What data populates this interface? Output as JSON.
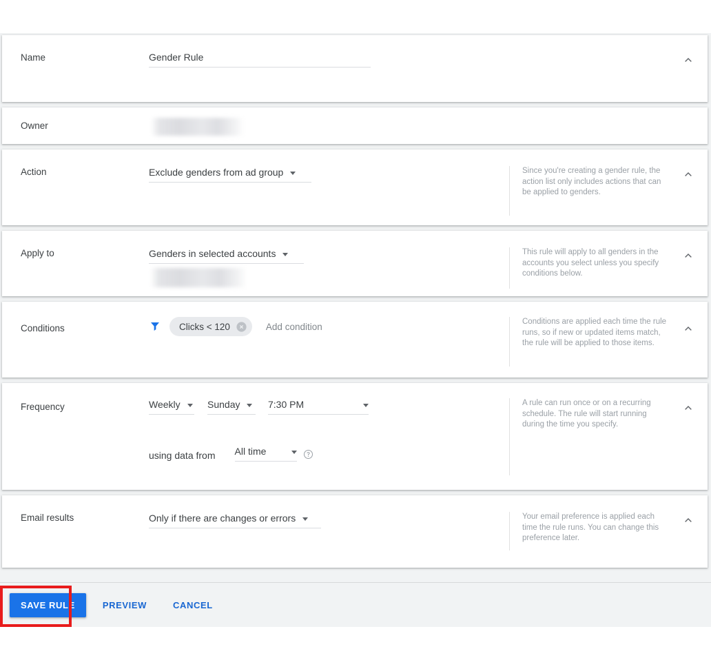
{
  "theme": {
    "accent": "#1a73e8",
    "link": "#1967d2",
    "page_bg": "#f1f3f4",
    "card_bg": "#ffffff",
    "label_color": "#3c4043",
    "help_color": "#9aa0a6",
    "chip_bg": "#e8eaed",
    "highlight": "#e81c1c"
  },
  "sections": {
    "name": {
      "label": "Name",
      "value": "Gender Rule",
      "placeholder": "Rule name",
      "toggle_icon": "chevron-up-icon"
    },
    "owner": {
      "label": "Owner",
      "value": "",
      "redacted": true
    },
    "action": {
      "label": "Action",
      "value": "Exclude genders from ad group",
      "help": "Since you're creating a gender rule, the action list only includes actions that can be applied to genders.",
      "toggle_icon": "chevron-up-icon"
    },
    "apply_to": {
      "label": "Apply to",
      "value": "Genders in selected accounts",
      "account_value": "",
      "help": "This rule will apply to all genders in the accounts you select unless you specify conditions below.",
      "toggle_icon": "chevron-up-icon"
    },
    "conditions": {
      "label": "Conditions",
      "filter_icon": "filter-icon",
      "chips": [
        {
          "text": "Clicks < 120",
          "remove_icon": "remove-circle-icon"
        }
      ],
      "add_label": "Add condition",
      "help": "Conditions are applied each time the rule runs, so if new or updated items match, the rule will be applied to those items.",
      "toggle_icon": "chevron-up-icon"
    },
    "frequency": {
      "label": "Frequency",
      "interval": "Weekly",
      "day": "Sunday",
      "time": "7:30 PM",
      "using_data_from_label": "using data from",
      "data_range": "All time",
      "help_icon": "help-circle-icon",
      "help": "A rule can run once or on a recurring schedule. The rule will start running during the time you specify.",
      "toggle_icon": "chevron-up-icon"
    },
    "email_results": {
      "label": "Email results",
      "value": "Only if there are changes or errors",
      "help": "Your email preference is applied each time the rule runs. You can change this preference later.",
      "toggle_icon": "chevron-up-icon"
    }
  },
  "actionbar": {
    "save_label": "SAVE RULE",
    "preview_label": "PREVIEW",
    "cancel_label": "CANCEL"
  }
}
